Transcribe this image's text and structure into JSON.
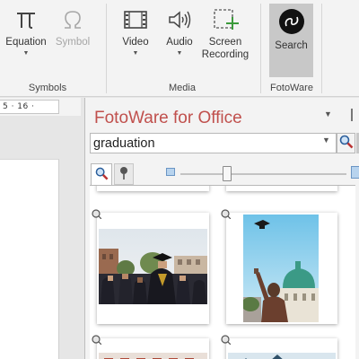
{
  "ribbon": {
    "symbols_group": {
      "label": "Symbols",
      "equation": {
        "label": "Equation",
        "icon": "pi-icon"
      },
      "symbol": {
        "label": "Symbol",
        "icon": "omega-icon",
        "disabled": true
      }
    },
    "media_group": {
      "label": "Media",
      "video": {
        "label": "Video",
        "icon": "film-icon"
      },
      "audio": {
        "label": "Audio",
        "icon": "speaker-icon"
      },
      "screen_recording": {
        "label1": "Screen",
        "label2": "Recording",
        "icon": "screen-recording-icon"
      }
    },
    "fotoware_group": {
      "label": "FotoWare",
      "search": {
        "label": "Search",
        "icon": "fotoware-logo-icon",
        "active": true
      }
    }
  },
  "ruler": {
    "text": "5 · 16 ·"
  },
  "pane": {
    "title": "FotoWare for Office",
    "title_color": "#c0504d",
    "search": {
      "value": "graduation"
    },
    "tabs": [
      {
        "name": "search",
        "icon": "magnifier-icon",
        "active": true
      },
      {
        "name": "pinned",
        "icon": "pin-icon",
        "active": false
      }
    ],
    "thumbnail_size_level": 0.28,
    "results": [
      {
        "subject": "graduates in caps and gowns, seen from behind",
        "icon": "pin-icon"
      },
      {
        "subject": "graduate tossing cap in front of domed building",
        "icon": "pin-icon"
      },
      {
        "subject": "partially visible result",
        "icon": "pin-icon"
      },
      {
        "subject": "partially visible result",
        "icon": "pin-icon"
      }
    ]
  }
}
